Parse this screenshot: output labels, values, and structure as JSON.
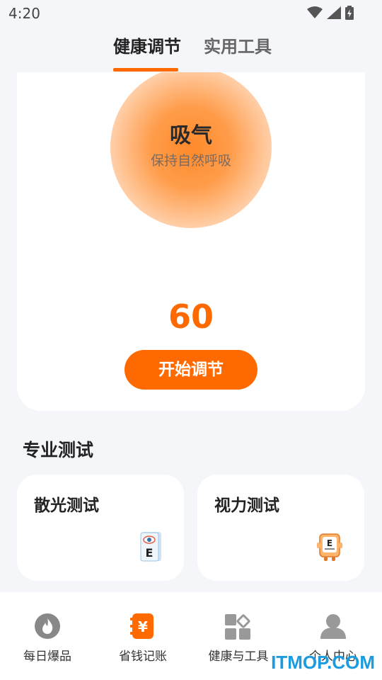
{
  "status": {
    "time": "4:20"
  },
  "tabs": [
    {
      "label": "健康调节",
      "active": true
    },
    {
      "label": "实用工具",
      "active": false
    }
  ],
  "breath": {
    "title": "吸气",
    "subtitle": "保持自然呼吸",
    "count": "60",
    "start_label": "开始调节"
  },
  "tests": {
    "section_title": "专业测试",
    "items": [
      {
        "label": "散光测试",
        "icon": "astigmatism-eye-chart-icon"
      },
      {
        "label": "视力测试",
        "icon": "vision-chart-mascot-icon"
      }
    ]
  },
  "nav": {
    "items": [
      {
        "label": "每日爆品",
        "icon": "flame-icon"
      },
      {
        "label": "省钱记账",
        "icon": "yuan-ledger-icon"
      },
      {
        "label": "健康与工具",
        "icon": "grid-tools-icon"
      },
      {
        "label": "个人中心",
        "icon": "user-icon"
      }
    ]
  },
  "watermark": "ITMOP.COM",
  "colors": {
    "accent": "#ff6a00",
    "background": "#f4f6fa",
    "watermark": "#1b9be0"
  }
}
